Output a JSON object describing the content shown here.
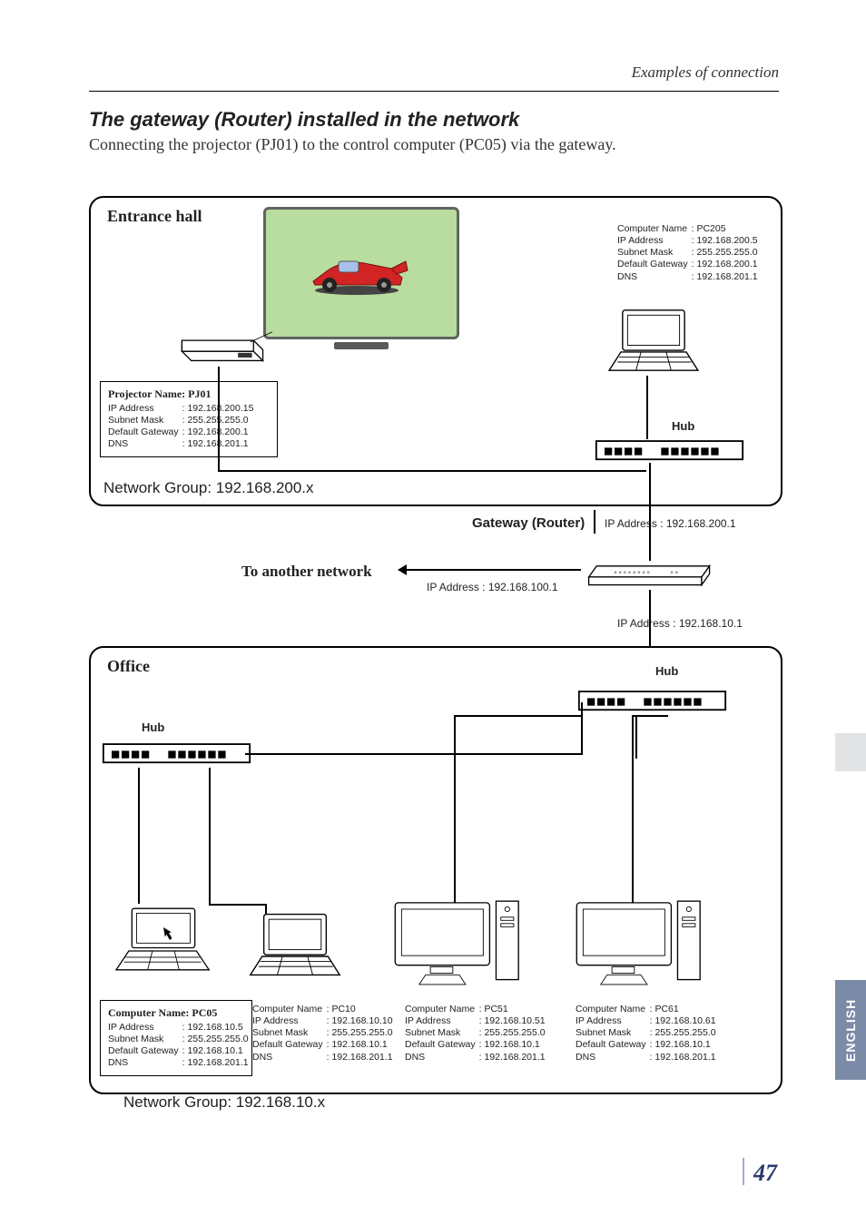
{
  "header": {
    "breadcrumb": "Examples of connection"
  },
  "section": {
    "title": "The gateway (Router) installed in the network",
    "lede": "Connecting the projector (PJ01) to the control computer (PC05) via the gateway."
  },
  "segment_top": {
    "title": "Entrance hall",
    "network_group": "Network Group: 192.168.200.x",
    "projector": {
      "title": "Projector Name: PJ01",
      "rows": [
        [
          "IP Address",
          ": 192.168.200.15"
        ],
        [
          "Subnet Mask",
          ": 255.255.255.0"
        ],
        [
          "Default Gateway",
          ": 192.168.200.1"
        ],
        [
          "DNS",
          ": 192.168.201.1"
        ]
      ]
    },
    "laptop_pc205": {
      "rows": [
        [
          "Computer Name",
          ": PC205"
        ],
        [
          "IP Address",
          ": 192.168.200.5"
        ],
        [
          "Subnet Mask",
          ": 255.255.255.0"
        ],
        [
          "Default Gateway",
          ": 192.168.200.1"
        ],
        [
          "DNS",
          ": 192.168.201.1"
        ]
      ]
    },
    "hub_label": "Hub"
  },
  "gateway": {
    "label": "Gateway (Router)",
    "ip_top": "IP Address : 192.168.200.1",
    "to_other": "To another network",
    "ip_mid": "IP Address : 192.168.100.1",
    "ip_bottom": "IP Address : 192.168.10.1"
  },
  "segment_bottom": {
    "title": "Office",
    "hub_label_1": "Hub",
    "hub_label_2": "Hub",
    "network_group": "Network Group: 192.168.10.x",
    "pc05": {
      "title": "Computer Name: PC05",
      "rows": [
        [
          "IP Address",
          ": 192.168.10.5"
        ],
        [
          "Subnet Mask",
          ": 255.255.255.0"
        ],
        [
          "Default Gateway",
          ": 192.168.10.1"
        ],
        [
          "DNS",
          ": 192.168.201.1"
        ]
      ]
    },
    "pc10": {
      "rows": [
        [
          "Computer Name",
          ": PC10"
        ],
        [
          "IP Address",
          ": 192.168.10.10"
        ],
        [
          "Subnet Mask",
          ": 255.255.255.0"
        ],
        [
          "Default Gateway",
          ": 192.168.10.1"
        ],
        [
          "DNS",
          ": 192.168.201.1"
        ]
      ]
    },
    "pc51": {
      "rows": [
        [
          "Computer Name",
          ": PC51"
        ],
        [
          "IP Address",
          ": 192.168.10.51"
        ],
        [
          "Subnet Mask",
          ": 255.255.255.0"
        ],
        [
          "Default Gateway",
          ": 192.168.10.1"
        ],
        [
          "DNS",
          ": 192.168.201.1"
        ]
      ]
    },
    "pc61": {
      "rows": [
        [
          "Computer Name",
          ": PC61"
        ],
        [
          "IP Address",
          ": 192.168.10.61"
        ],
        [
          "Subnet Mask",
          ": 255.255.255.0"
        ],
        [
          "Default Gateway",
          ": 192.168.10.1"
        ],
        [
          "DNS",
          ": 192.168.201.1"
        ]
      ]
    }
  },
  "page_number": "47",
  "side_tab": "ENGLISH"
}
